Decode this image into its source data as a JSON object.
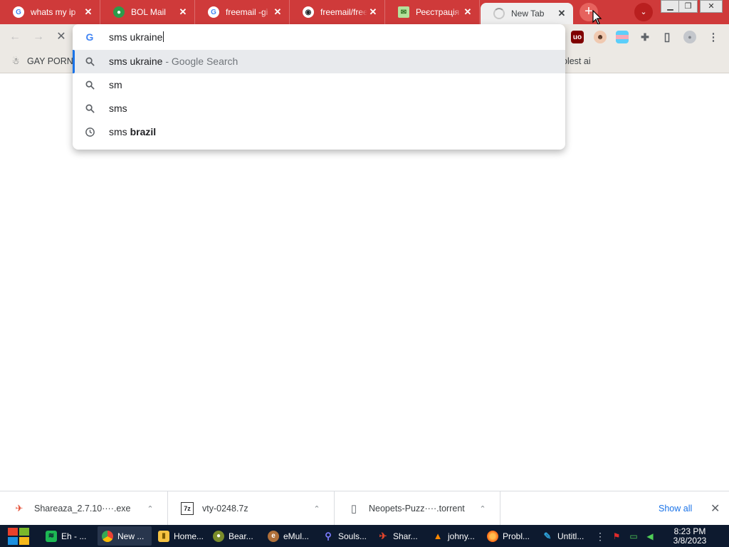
{
  "tabs": [
    {
      "title": "whats my ip",
      "icon": "google-icon",
      "close": "✕"
    },
    {
      "title": "BOL Mail",
      "icon": "bol-mail-icon",
      "close": "✕"
    },
    {
      "title": "freemail -gi",
      "icon": "google-icon",
      "close": "✕"
    },
    {
      "title": "freemail/free",
      "icon": "github-icon",
      "close": "✕"
    },
    {
      "title": "Реєстрація",
      "icon": "mail-icon",
      "close": "✕"
    },
    {
      "title": "New Tab",
      "icon": "loading-spinner-icon",
      "close": "✕"
    }
  ],
  "tabstrip": {
    "new_tab": "+",
    "tab_search": "⌄"
  },
  "window_controls": {
    "minimize": "▁",
    "restore": "❐",
    "close": "✕"
  },
  "toolbar": {
    "back": "←",
    "forward": "→",
    "stop": "✕",
    "extensions": [
      {
        "name": "ublock-origin-icon",
        "label": "uo"
      },
      {
        "name": "avatar-extension-icon",
        "label": "☻"
      },
      {
        "name": "flag-extension-icon",
        "label": ""
      },
      {
        "name": "puzzle-extensions-icon",
        "label": "✚"
      },
      {
        "name": "side-panel-icon",
        "label": "▯"
      },
      {
        "name": "profile-icon",
        "label": "●"
      },
      {
        "name": "kebab-menu-icon",
        "label": "⋮"
      }
    ]
  },
  "bookmarks": [
    {
      "label": "GAY PORN",
      "icon": "bookmark-favicon-icon"
    },
    {
      "label": "olest ai",
      "icon": ""
    }
  ],
  "omnibox": {
    "google_glyph": "G",
    "input_text": "sms ukraine",
    "suggestions": [
      {
        "icon": "search-icon",
        "text": "sms ukraine",
        "bold": "",
        "separator": " - ",
        "description": "Google Search",
        "selected": true
      },
      {
        "icon": "search-icon",
        "text": "sm",
        "bold": "",
        "separator": "",
        "description": "",
        "selected": false
      },
      {
        "icon": "search-icon",
        "text": "sms",
        "bold": "",
        "separator": "",
        "description": "",
        "selected": false
      },
      {
        "icon": "history-clock-icon",
        "text": "sms ",
        "bold": "brazil",
        "separator": "",
        "description": "",
        "selected": false
      }
    ]
  },
  "downloads": {
    "items": [
      {
        "name": "Shareaza_2.7.10····.exe",
        "icon": "shareaza-icon"
      },
      {
        "name": "vty-0248.7z",
        "icon": "archive-7z-icon"
      },
      {
        "name": "Neopets-Puzz····.torrent",
        "icon": "file-icon"
      }
    ],
    "show_all": "Show all",
    "close": "✕",
    "chevron": "⌃"
  },
  "taskbar": {
    "items": [
      {
        "label": "Eh - ...",
        "icon": "spotify-icon",
        "color": "#1db954"
      },
      {
        "label": "New ...",
        "icon": "chrome-icon",
        "color": "#4285f4",
        "active": true
      },
      {
        "label": "Home...",
        "icon": "folder-icon",
        "color": "#f5c242"
      },
      {
        "label": "Bear...",
        "icon": "bear-app-icon",
        "color": "#7a8c2a"
      },
      {
        "label": "eMul...",
        "icon": "emule-icon",
        "color": "#b0703a"
      },
      {
        "label": "Souls...",
        "icon": "souls-icon",
        "color": "#5b5bd6"
      },
      {
        "label": "Shar...",
        "icon": "shareaza-icon",
        "color": "#e2452b"
      },
      {
        "label": "johny...",
        "icon": "vlc-icon",
        "color": "#ff8800"
      },
      {
        "label": "Probl...",
        "icon": "firefox-icon",
        "color": "#ff6611"
      },
      {
        "label": "Untitl...",
        "icon": "paint-icon",
        "color": "#2ea1d8"
      }
    ],
    "clock_time": "8:23 PM",
    "clock_date": "3/8/2023"
  },
  "colors": {
    "tab_strip": "#cf3a3a",
    "toolbar": "#ece9e4",
    "selected_row": "#e8eaed",
    "accent": "#1a73e8",
    "taskbar": "#0d1a2f"
  }
}
